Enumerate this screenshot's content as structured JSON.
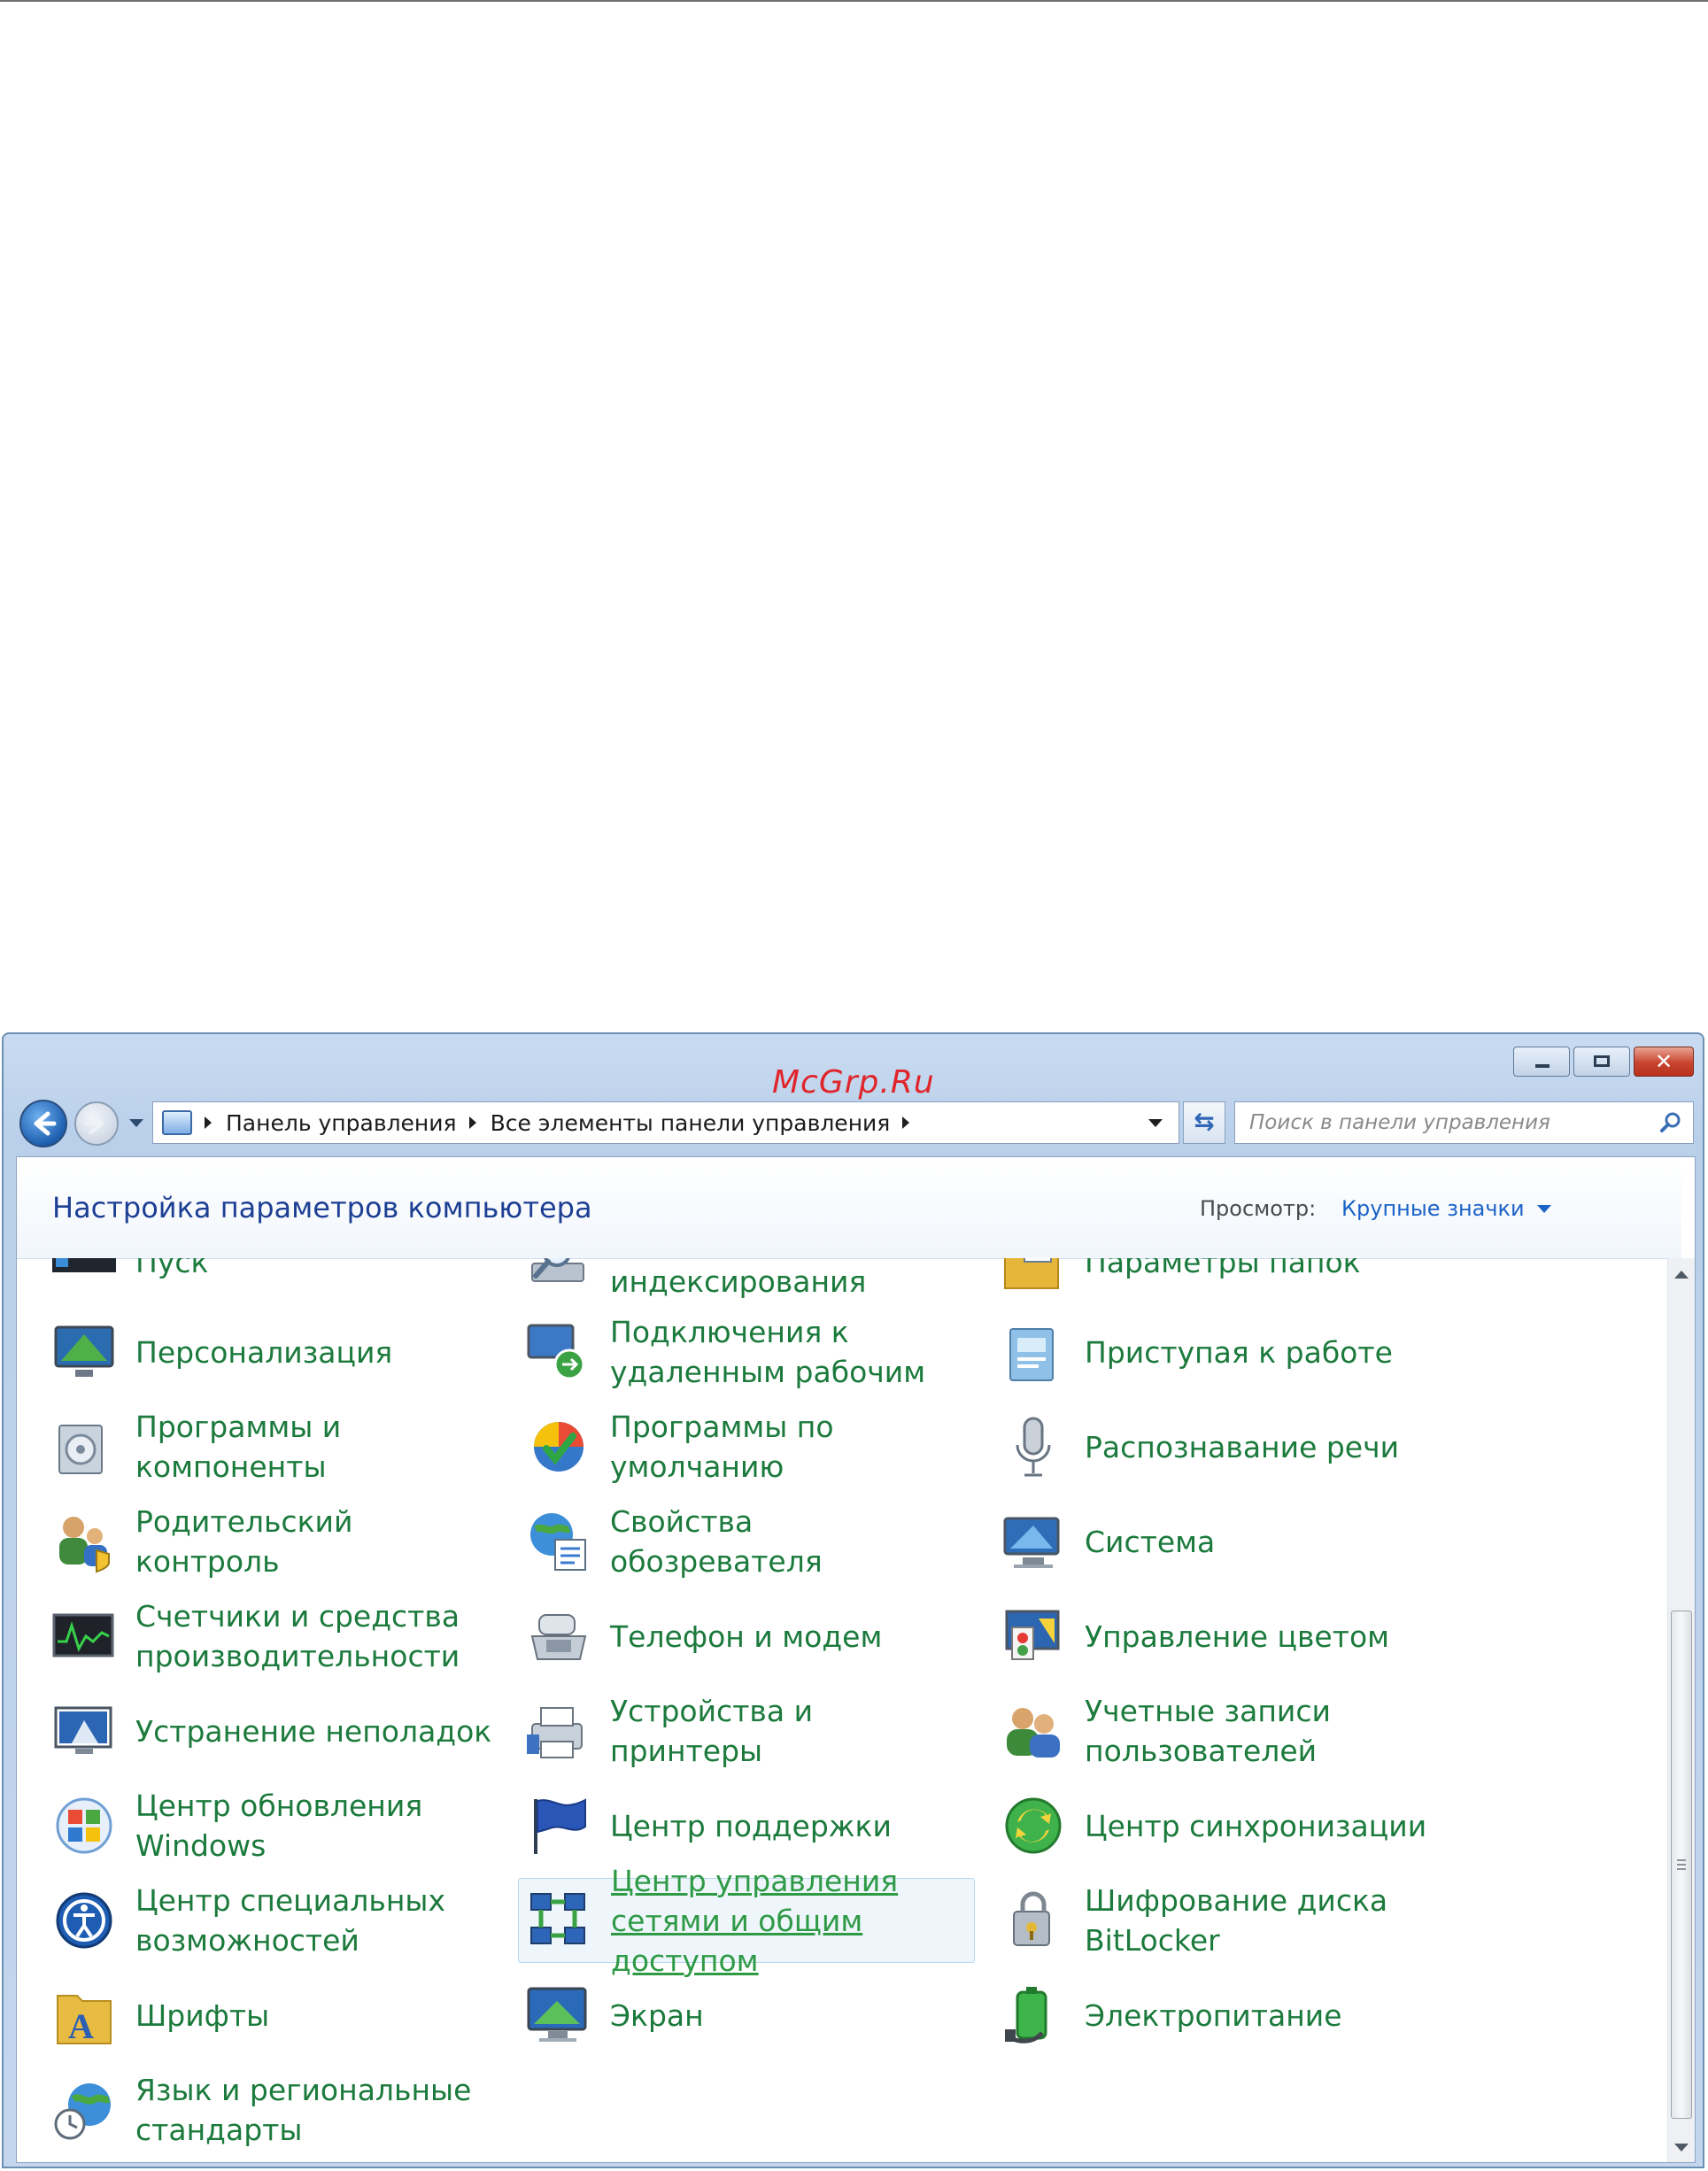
{
  "watermark": "McGrp.Ru",
  "breadcrumb": [
    "Панель управления",
    "Все элементы панели управления"
  ],
  "search": {
    "placeholder": "Поиск в панели управления"
  },
  "header": {
    "title": "Настройка параметров компьютера",
    "view_label": "Просмотр:",
    "view_value": "Крупные значки"
  },
  "colors": {
    "link_green": "#1b7a3c",
    "title_blue": "#1c3f94",
    "accent_blue": "#1c63c8"
  },
  "items": [
    {
      "label": "Пуск",
      "icon": "taskbar-start-icon",
      "selected": false
    },
    {
      "label": "Параметры индексирования",
      "icon": "indexing-options-icon",
      "selected": false
    },
    {
      "label": "Параметры папок",
      "icon": "folder-options-icon",
      "selected": false
    },
    {
      "label": "Персонализация",
      "icon": "personalization-icon",
      "selected": false
    },
    {
      "label": "Подключения к удаленным рабочим",
      "icon": "remote-desktop-icon",
      "selected": false
    },
    {
      "label": "Приступая к работе",
      "icon": "getting-started-icon",
      "selected": false
    },
    {
      "label": "Программы и компоненты",
      "icon": "programs-features-icon",
      "selected": false
    },
    {
      "label": "Программы по умолчанию",
      "icon": "default-programs-icon",
      "selected": false
    },
    {
      "label": "Распознавание речи",
      "icon": "microphone-icon",
      "selected": false
    },
    {
      "label": "Родительский контроль",
      "icon": "parental-controls-icon",
      "selected": false
    },
    {
      "label": "Свойства обозревателя",
      "icon": "internet-options-icon",
      "selected": false
    },
    {
      "label": "Система",
      "icon": "system-icon",
      "selected": false
    },
    {
      "label": "Счетчики и средства производительности",
      "icon": "performance-icon",
      "selected": false
    },
    {
      "label": "Телефон и модем",
      "icon": "phone-modem-icon",
      "selected": false
    },
    {
      "label": "Управление цветом",
      "icon": "color-management-icon",
      "selected": false
    },
    {
      "label": "Устранение неполадок",
      "icon": "troubleshooting-icon",
      "selected": false
    },
    {
      "label": "Устройства и принтеры",
      "icon": "devices-printers-icon",
      "selected": false
    },
    {
      "label": "Учетные записи пользователей",
      "icon": "user-accounts-icon",
      "selected": false
    },
    {
      "label": "Центр обновления Windows",
      "icon": "windows-update-icon",
      "selected": false
    },
    {
      "label": "Центр поддержки",
      "icon": "action-center-flag-icon",
      "selected": false
    },
    {
      "label": "Центр синхронизации",
      "icon": "sync-center-icon",
      "selected": false
    },
    {
      "label": "Центр специальных возможностей",
      "icon": "ease-of-access-icon",
      "selected": false
    },
    {
      "label": "Центр управления сетями и общим доступом",
      "icon": "network-sharing-icon",
      "selected": true
    },
    {
      "label": "Шифрование диска BitLocker",
      "icon": "bitlocker-icon",
      "selected": false
    },
    {
      "label": "Шрифты",
      "icon": "fonts-folder-icon",
      "selected": false
    },
    {
      "label": "Экран",
      "icon": "display-icon",
      "selected": false
    },
    {
      "label": "Электропитание",
      "icon": "power-options-icon",
      "selected": false
    },
    {
      "label": "Язык и региональные стандарты",
      "icon": "region-language-icon",
      "selected": false
    }
  ]
}
